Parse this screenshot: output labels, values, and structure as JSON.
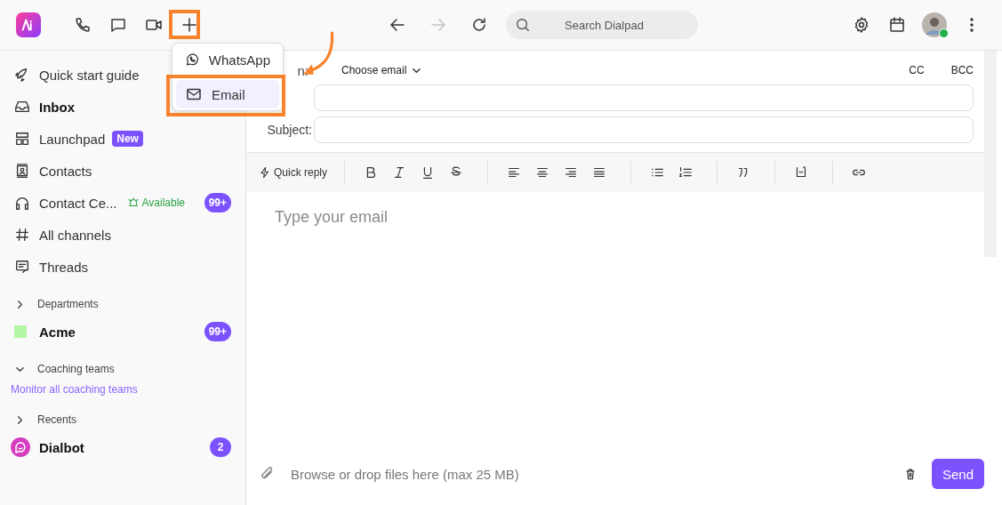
{
  "top_bar": {
    "forward_disabled": true,
    "search": {
      "placeholder": "Search Dialpad"
    },
    "user": {
      "online": true
    }
  },
  "new_menu": {
    "items": [
      {
        "kind": "whatsapp",
        "label": "WhatsApp",
        "selected": false
      },
      {
        "kind": "email",
        "label": "Email",
        "selected": true
      }
    ]
  },
  "sidebar": {
    "items": [
      {
        "kind": "rocket",
        "label": "Quick start guide",
        "selected": false
      },
      {
        "kind": "inbox",
        "label": "Inbox",
        "selected": true
      },
      {
        "kind": "launchpad",
        "label": "Launchpad",
        "selected": false,
        "tag": "New"
      },
      {
        "kind": "contacts",
        "label": "Contacts",
        "selected": false
      },
      {
        "kind": "headset",
        "label": "Contact Ce...",
        "selected": false,
        "status": "Available",
        "count": "99+"
      },
      {
        "kind": "hash",
        "label": "All channels",
        "selected": false
      },
      {
        "kind": "threads",
        "label": "Threads",
        "selected": false
      }
    ],
    "sections": [
      {
        "title": "Departments",
        "expanded": false,
        "items": [
          {
            "kind": "team",
            "label": "Acme",
            "color": "#b4f7a6",
            "count": "99+"
          }
        ]
      },
      {
        "title": "Coaching teams",
        "expanded": true,
        "link": "Monitor all coaching teams"
      },
      {
        "title": "Recents",
        "expanded": false,
        "items": [
          {
            "kind": "bot",
            "label": "Dialbot",
            "count": "2"
          }
        ]
      }
    ]
  },
  "compose": {
    "from_label": "n:",
    "from_select": "Choose email",
    "cc": "CC",
    "bcc": "BCC",
    "subject_label": "Subject:",
    "quick_reply": "Quick reply",
    "body": {
      "placeholder": "Type your email"
    },
    "attach": {
      "placeholder": "Browse or drop files here (max 25 MB)"
    },
    "send": "Send"
  }
}
